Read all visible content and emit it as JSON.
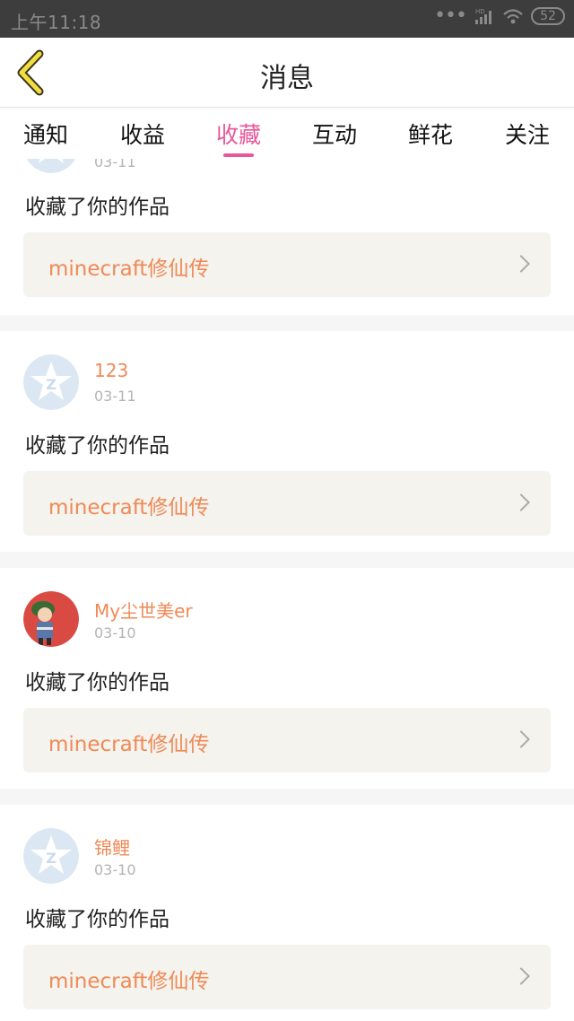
{
  "status_bar": {
    "time": "上午11:18",
    "signal": "HD",
    "battery": "52"
  },
  "header": {
    "title": "消息",
    "back_icon": "chevron-left-icon"
  },
  "tabs": [
    {
      "label": "通知"
    },
    {
      "label": "收益"
    },
    {
      "label": "收藏",
      "active": true
    },
    {
      "label": "互动"
    },
    {
      "label": "鲜花"
    },
    {
      "label": "关注"
    }
  ],
  "messages": [
    {
      "name": "",
      "date": "03-11",
      "action": "收藏了你的作品",
      "work": "minecraft修仙传",
      "avatar": "qq-star-avatar"
    },
    {
      "name": "123",
      "date": "03-11",
      "action": "收藏了你的作品",
      "work": "minecraft修仙传",
      "avatar": "qq-star-avatar"
    },
    {
      "name": "My尘世美er",
      "date": "03-10",
      "action": "收藏了你的作品",
      "work": "minecraft修仙传",
      "avatar": "photo-avatar"
    },
    {
      "name": "锦鲤",
      "date": "03-10",
      "action": "收藏了你的作品",
      "work": "minecraft修仙传",
      "avatar": "qq-star-avatar"
    }
  ],
  "colors": {
    "accent": "#e8579a",
    "orange": "#ef8a56",
    "workbox": "#f4f3ee"
  }
}
